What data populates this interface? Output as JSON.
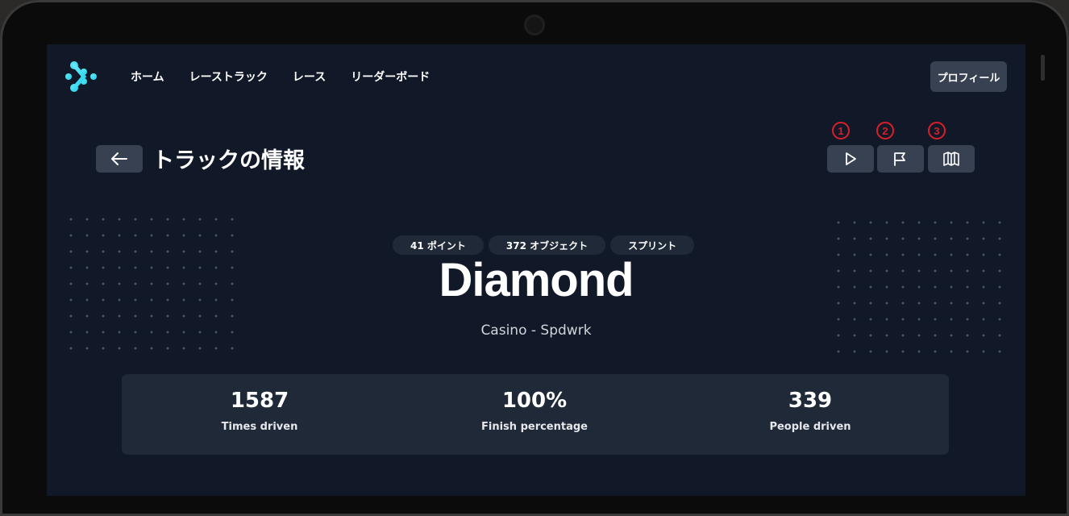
{
  "nav": {
    "items": [
      {
        "label": "ホーム"
      },
      {
        "label": "レーストラック"
      },
      {
        "label": "レース"
      },
      {
        "label": "リーダーボード"
      }
    ],
    "profile_label": "プロフィール"
  },
  "page": {
    "title": "トラックの情報"
  },
  "actions": [
    {
      "marker": "1",
      "icon": "play-icon"
    },
    {
      "marker": "2",
      "icon": "flag-icon"
    },
    {
      "marker": "3",
      "icon": "map-icon"
    }
  ],
  "track": {
    "tags": [
      "41 ポイント",
      "372 オブジェクト",
      "スプリント"
    ],
    "name": "Diamond",
    "subtitle": "Casino - Spdwrk"
  },
  "stats": [
    {
      "value": "1587",
      "label": "Times driven"
    },
    {
      "value": "100%",
      "label": "Finish percentage"
    },
    {
      "value": "339",
      "label": "People driven"
    }
  ],
  "colors": {
    "background": "#111827",
    "panel": "#1f2937",
    "button": "#374151",
    "accent": "#22d3ee",
    "marker": "#d8202a"
  }
}
